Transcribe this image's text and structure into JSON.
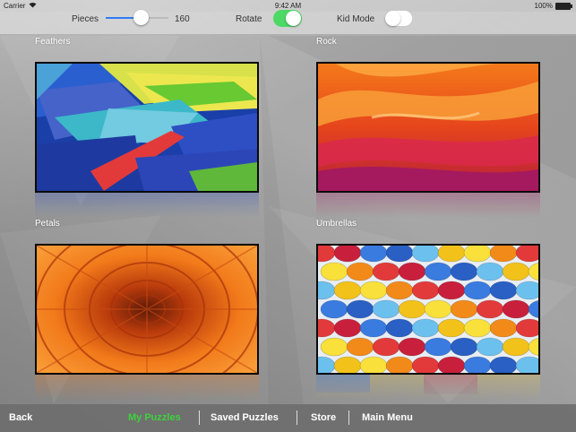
{
  "status_bar": {
    "carrier": "Carrier",
    "time": "9:42 AM",
    "battery": "100%"
  },
  "controls": {
    "pieces_label": "Pieces",
    "pieces_value": "160",
    "pieces_level": 0.55,
    "rotate_label": "Rotate",
    "rotate_on": true,
    "kid_mode_label": "Kid Mode",
    "kid_mode_on": false
  },
  "puzzles": [
    {
      "title": "Feathers"
    },
    {
      "title": "Rock"
    },
    {
      "title": "Petals"
    },
    {
      "title": "Umbrellas"
    }
  ],
  "bottom_nav": {
    "back": "Back",
    "my_puzzles": "My Puzzles",
    "saved_puzzles": "Saved Puzzles",
    "store": "Store",
    "main_menu": "Main Menu",
    "active_color": "#3cd33c"
  }
}
